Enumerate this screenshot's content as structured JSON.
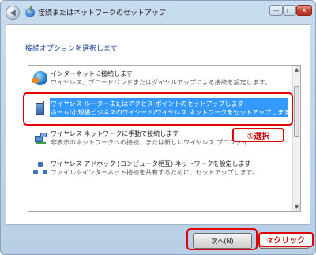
{
  "window": {
    "title": "接続またはネットワークのセットアップ",
    "controls": {
      "minimize": "—",
      "maximize": "▢",
      "close": "✕"
    }
  },
  "content": {
    "heading": "接続オプションを選択します"
  },
  "options": [
    {
      "title": "インターネットに接続します",
      "description": "ワイヤレス、ブロードバンドまたはダイヤルアップによる接続を設定します。",
      "icon": "globe-icon"
    },
    {
      "title": "ワイヤレス ルーターまたはアクセス ポイントのセットアップします",
      "description": "ホーム/小規模ビジネスのワイヤード/ワイヤレス ネットワークをセットアップします。",
      "icon": "router-icon"
    },
    {
      "title": "ワイヤレス ネットワークに手動で接続します",
      "description": "非表示のネットワークへの接続、または新しいワイヤレス プロファイ",
      "icon": "network-icon"
    },
    {
      "title": "ワイヤレス アドホック (コンピュータ相互) ネットワークを設定します",
      "description": "ファイルやインターネット接続を共有するために、セットアップします。",
      "icon": "adhoc-network-icon"
    }
  ],
  "annotations": {
    "step1": "①選択",
    "step2": "②クリック"
  },
  "buttons": {
    "next": "次へ(N)",
    "cancel": ""
  },
  "colors": {
    "selection": "#3399ff",
    "callout": "#e10000",
    "heading": "#16398c"
  }
}
